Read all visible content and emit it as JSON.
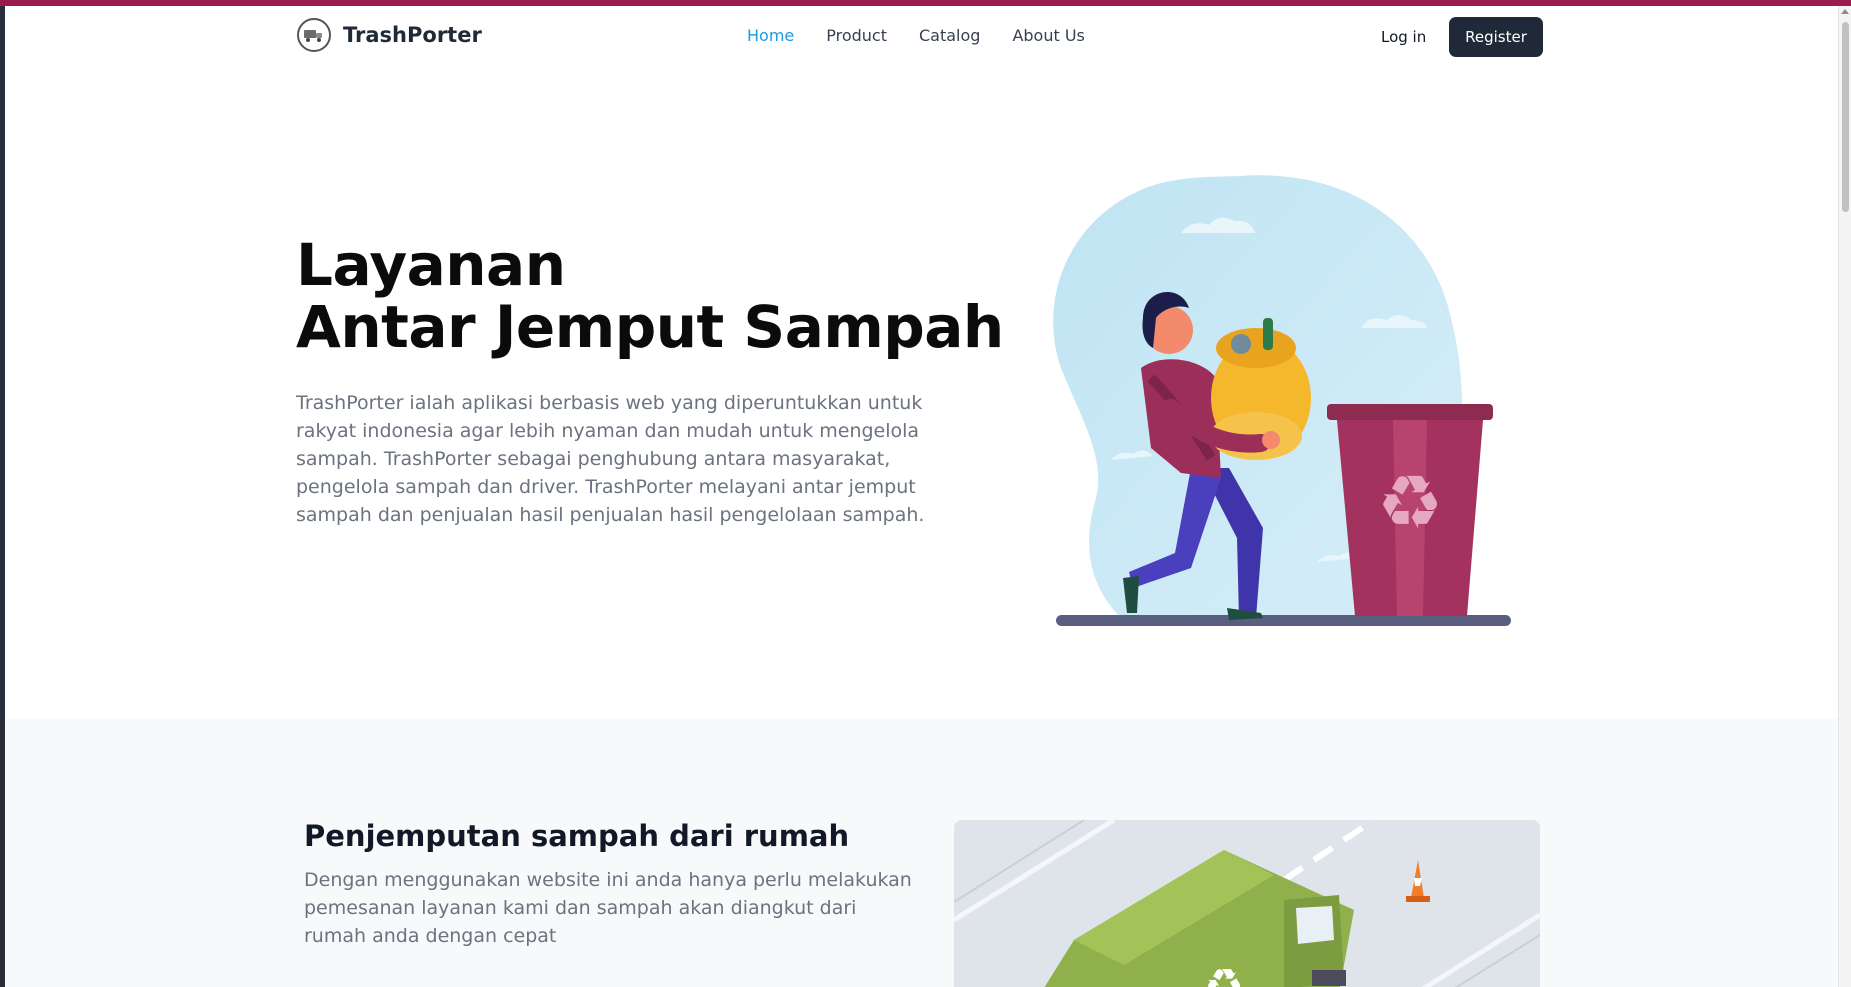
{
  "brand": {
    "name": "TrashPorter",
    "logo_icon": "truck-logo-icon"
  },
  "nav": {
    "items": [
      {
        "label": "Home",
        "active": true
      },
      {
        "label": "Product",
        "active": false
      },
      {
        "label": "Catalog",
        "active": false
      },
      {
        "label": "About Us",
        "active": false
      }
    ]
  },
  "auth": {
    "login_label": "Log in",
    "register_label": "Register"
  },
  "hero": {
    "title_line1": "Layanan",
    "title_line2": "Antar Jemput Sampah",
    "description": "TrashPorter ialah aplikasi berbasis web yang diperuntukkan untuk rakyat indonesia agar lebih nyaman dan mudah untuk mengelola sampah. TrashPorter sebagai penghubung antara masyarakat, pengelola sampah dan driver. TrashPorter melayani antar jemput sampah dan penjualan hasil penjualan hasil pengelolaan sampah.",
    "illustration_icon": "person-carrying-trash-bag-illustration"
  },
  "features": {
    "title": "Penjemputan sampah dari rumah",
    "description": "Dengan menggunakan website ini anda hanya perlu melakukan pemesanan layanan kami dan sampah akan diangkut dari rumah anda dengan cepat",
    "image_icon": "garbage-truck-illustration"
  },
  "colors": {
    "accent": "#1c9be3",
    "primary_button": "#1f2937",
    "top_strip": "#9b1b4e",
    "trash_bin": "#a3325e",
    "truck": "#8fb04a"
  }
}
